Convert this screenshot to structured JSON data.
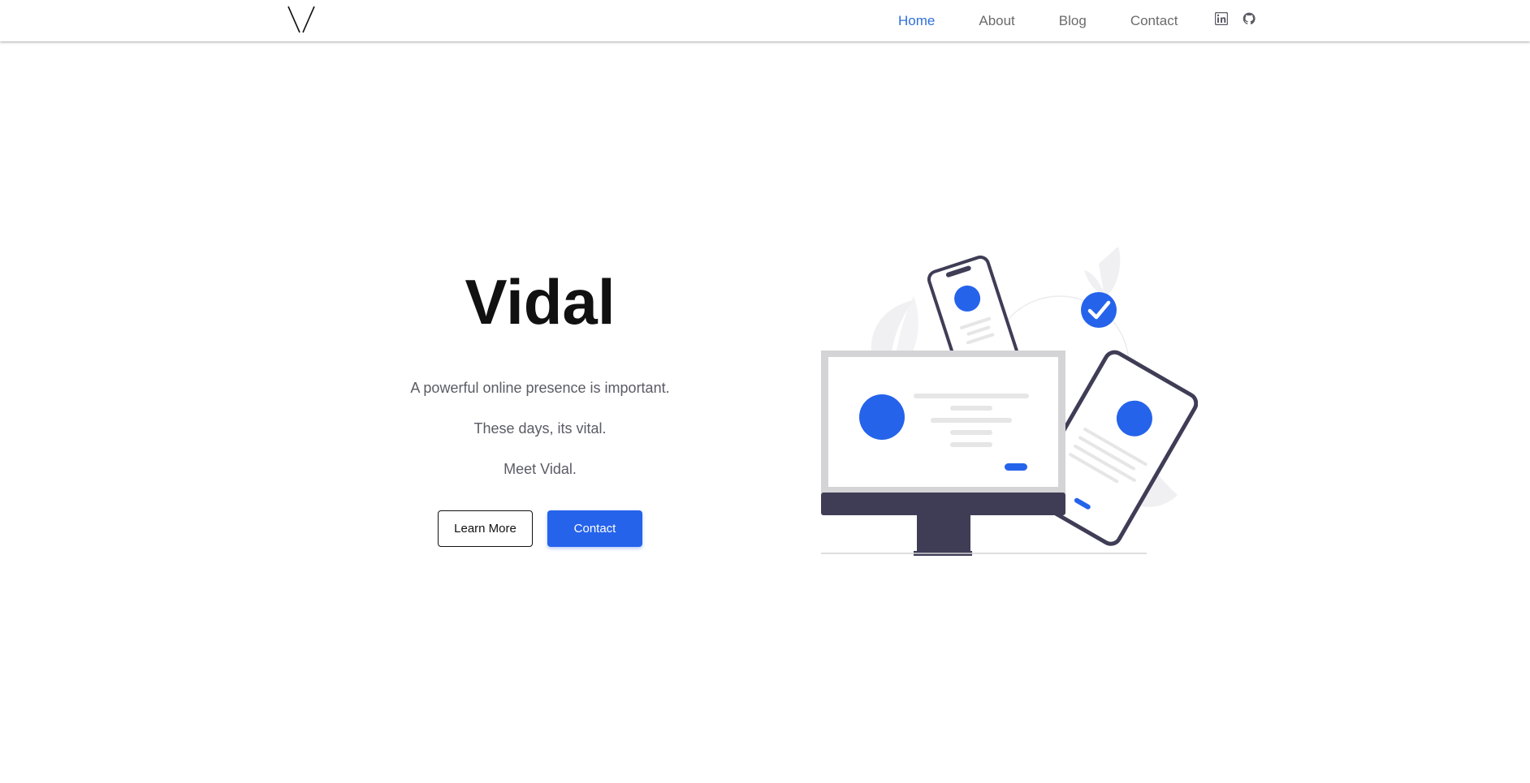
{
  "nav": {
    "logo_alt": "V",
    "links": [
      {
        "label": "Home",
        "active": true
      },
      {
        "label": "About",
        "active": false
      },
      {
        "label": "Blog",
        "active": false
      },
      {
        "label": "Contact",
        "active": false
      }
    ],
    "icons": [
      "linkedin-icon",
      "github-icon"
    ]
  },
  "hero": {
    "title": "Vidal",
    "lines": [
      "A powerful online presence is important.",
      "These days, its vital.",
      "Meet Vidal."
    ],
    "buttons": {
      "learn_more": "Learn More",
      "contact": "Contact"
    }
  },
  "colors": {
    "accent": "#2563eb",
    "nav_active": "#2f6fdb",
    "device_dark": "#3f3d56"
  }
}
